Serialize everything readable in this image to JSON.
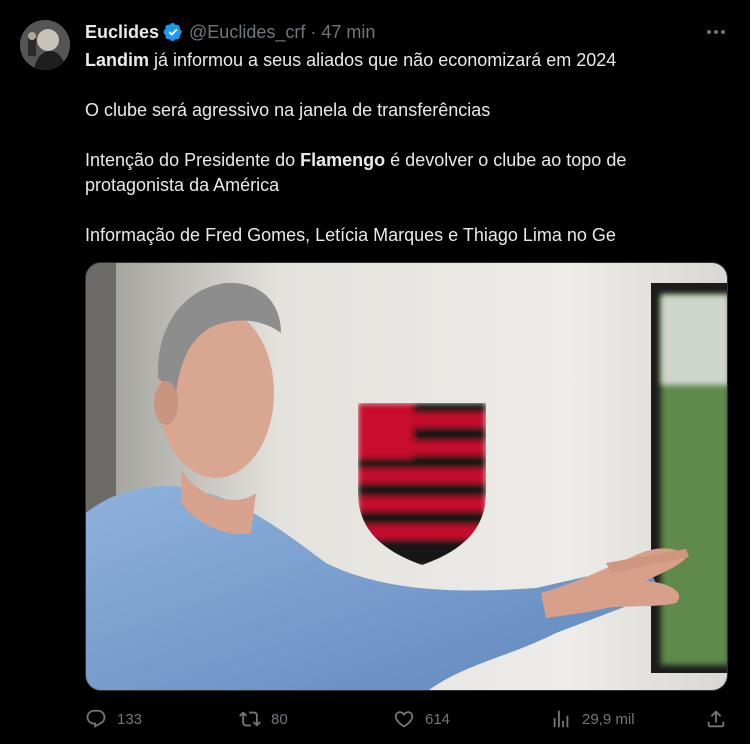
{
  "author": {
    "name": "Euclides",
    "handle": "@Euclides_crf",
    "separator": "·",
    "time": "47 min",
    "verified": true
  },
  "tweet": {
    "line1_bold": "Landim",
    "line1_rest": " já informou a seus aliados que não economizará em 2024",
    "line2": "O clube será agressivo na janela de transferências",
    "line3_pre": "Intenção do Presidente do ",
    "line3_bold": "Flamengo",
    "line3_post": " é devolver o clube ao topo de protagonista da América",
    "line4": "Informação de Fred Gomes, Letícia Marques e Thiago Lima no Ge"
  },
  "actions": {
    "replies": "133",
    "retweets": "80",
    "likes": "614",
    "views": "29,9 mil"
  },
  "icons": {
    "verified": "verified-badge-icon",
    "more": "more-options-icon",
    "reply": "reply-icon",
    "retweet": "retweet-icon",
    "like": "heart-icon",
    "views": "views-chart-icon",
    "share": "share-icon"
  },
  "colors": {
    "background": "#000000",
    "text": "#e7e9ea",
    "muted": "#71767b",
    "verified": "#1d9bf0"
  }
}
